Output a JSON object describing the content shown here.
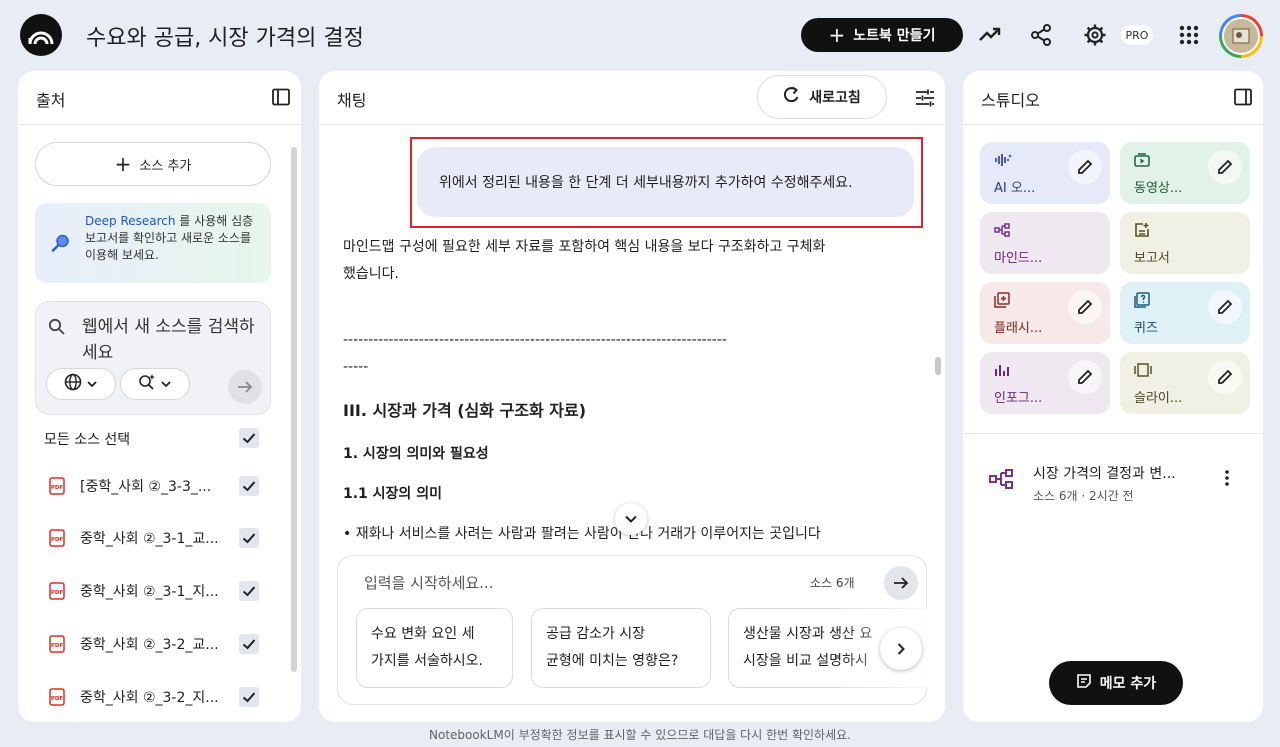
{
  "app": {
    "title": "수요와 공급, 시장 가격의 결정",
    "create_label": "노트북 만들기",
    "pro_badge": "PRO"
  },
  "sources": {
    "title": "출처",
    "add_label": "소스 추가",
    "deep_research_link": "Deep Research",
    "deep_research_text": " 를 사용해 심층 보고서를 확인하고 새로운 소스를 이용해 보세요.",
    "search_placeholder": "웹에서 새 소스를 검색하세요",
    "select_all_label": "모든 소스 선택",
    "items": [
      {
        "label": "[중학_사회 ②_3-3_...",
        "checked": true
      },
      {
        "label": "중학_사회 ②_3-1_교...",
        "checked": true
      },
      {
        "label": "중학_사회 ②_3-1_지...",
        "checked": true
      },
      {
        "label": "중학_사회 ②_3-2_교...",
        "checked": true
      },
      {
        "label": "중학_사회 ②_3-2_지...",
        "checked": true
      }
    ]
  },
  "chat": {
    "title": "채팅",
    "refresh_label": "새로고침",
    "user_message": "위에서 정리된 내용을 한 단계 더 세부내용까지 추가하여 수정해주세요.",
    "response_intro_1": "마인드맵 구성에 필요한 세부 자료를 포함하여 핵심 내용을 보다 구조화하고 구체화",
    "response_intro_2": "했습니다.",
    "separator_1": "----------------------------------------------------------------------------",
    "separator_2": "-----",
    "heading": "III. 시장과 가격 (심화 구조화 자료)",
    "subheading_1": "1. 시장의 의미와 필요성",
    "subheading_2": "1.1 시장의 의미",
    "bullet_1": "• 재화나 서비스를 사려는 사람과 팔려는 사람이 만나 거래가 이루어지는 곳입니다",
    "input_placeholder": "입력을 시작하세요...",
    "source_count": "소스 6개",
    "suggestions": [
      {
        "line1": "수요 변화 요인 세",
        "line2": "가지를 서술하시오."
      },
      {
        "line1": "공급 감소가 시장",
        "line2": "균형에 미치는 영향은?"
      },
      {
        "line1": "생산물 시장과 생산 요",
        "line2": "시장을 비교 설명하시"
      }
    ]
  },
  "studio": {
    "title": "스튜디오",
    "tiles": [
      {
        "label": "AI 오...",
        "icon": "audio-icon",
        "color": "#e6e9f8"
      },
      {
        "label": "동영상...",
        "icon": "video-icon",
        "color": "#e3f2e8"
      },
      {
        "label": "마인드...",
        "icon": "mindmap-icon",
        "color": "#efe8f1"
      },
      {
        "label": "보고서",
        "icon": "report-icon",
        "color": "#f1f0e4"
      },
      {
        "label": "플래시...",
        "icon": "flashcard-icon",
        "color": "#f6e9e7"
      },
      {
        "label": "퀴즈",
        "icon": "quiz-icon",
        "color": "#dff0f6"
      },
      {
        "label": "인포그...",
        "icon": "infographic-icon",
        "color": "#efe8f1"
      },
      {
        "label": "슬라이...",
        "icon": "slides-icon",
        "color": "#f1f0e4"
      }
    ],
    "note_title": "시장 가격의 결정과 변...",
    "note_meta": "소스 6개 · 2시간 전",
    "memo_label": "메모 추가"
  },
  "footer": {
    "disclaimer": "NotebookLM이 부정확한 정보를 표시할 수 있으므로 대답을 다시 한번 확인하세요."
  }
}
